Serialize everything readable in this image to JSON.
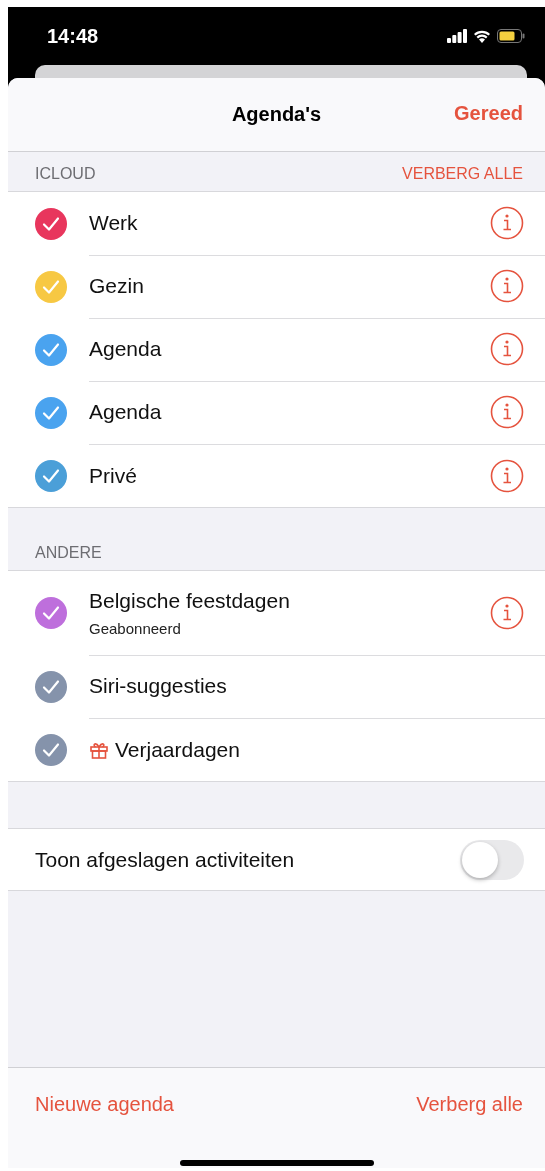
{
  "status_bar": {
    "time": "14:48"
  },
  "header": {
    "title": "Agenda's",
    "done": "Gereed"
  },
  "sections": [
    {
      "title": "ICLOUD",
      "action": "VERBERG ALLE",
      "items": [
        {
          "name": "Werk",
          "kind": "calendar",
          "checked": true,
          "color": "#e8365d",
          "info": true
        },
        {
          "name": "Gezin",
          "kind": "calendar",
          "checked": true,
          "color": "#f7c843",
          "info": true
        },
        {
          "name": "Agenda",
          "kind": "calendar",
          "checked": true,
          "color": "#4aa3ef",
          "info": true
        },
        {
          "name": "Agenda",
          "kind": "calendar",
          "checked": true,
          "color": "#4aa3ef",
          "info": true
        },
        {
          "name": "Privé",
          "kind": "calendar",
          "checked": true,
          "color": "#4b9fd8",
          "info": true
        }
      ]
    },
    {
      "title": "ANDERE",
      "items": [
        {
          "name": "Belgische feestdagen",
          "subtitle": "Geabonneerd",
          "kind": "calendar",
          "checked": true,
          "color": "#be6fdc",
          "info": true
        },
        {
          "name": "Siri-suggesties",
          "kind": "calendar",
          "checked": true,
          "color": "#8593ab",
          "info": false
        },
        {
          "name": "Verjaardagen",
          "kind": "birthdays",
          "checked": true,
          "color": "#8593ab",
          "info": false
        }
      ]
    }
  ],
  "toggle": {
    "label": "Toon afgeslagen activiteiten",
    "on": false
  },
  "footer": {
    "left": "Nieuwe agenda",
    "right": "Verberg alle"
  }
}
